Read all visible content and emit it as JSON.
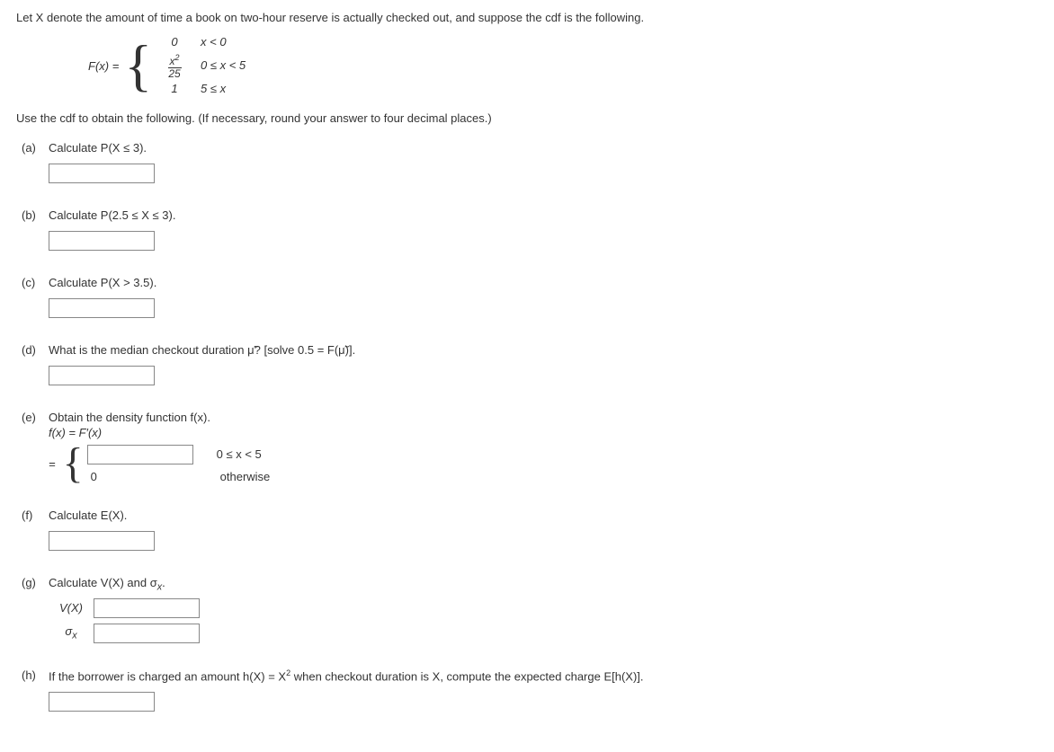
{
  "intro": "Let X denote the amount of time a book on two-hour reserve is actually checked out, and suppose the cdf is the following.",
  "cdf": {
    "func": "F(x) =",
    "cases": [
      {
        "val": "0",
        "cond": "x < 0"
      },
      {
        "val_num": "x",
        "val_sup": "2",
        "val_den": "25",
        "cond": "0 ≤ x < 5"
      },
      {
        "val": "1",
        "cond": "5 ≤ x"
      }
    ]
  },
  "instruction": "Use the cdf to obtain the following. (If necessary, round your answer to four decimal places.)",
  "parts": {
    "a": {
      "tag": "(a)",
      "text": "Calculate P(X ≤ 3)."
    },
    "b": {
      "tag": "(b)",
      "text": "Calculate P(2.5 ≤ X ≤ 3)."
    },
    "c": {
      "tag": "(c)",
      "text": "Calculate P(X > 3.5)."
    },
    "d": {
      "tag": "(d)",
      "text": "What is the median checkout duration μ̃? [solve 0.5 = F(μ̃)]."
    },
    "e": {
      "tag": "(e)",
      "text": "Obtain the density function f(x).",
      "sub": "f(x) = F′(x)",
      "eq": "=",
      "cond1": "0 ≤ x < 5",
      "val2": "0",
      "cond2": "otherwise"
    },
    "f": {
      "tag": "(f)",
      "text": "Calculate E(X)."
    },
    "g": {
      "tag": "(g)",
      "text_prefix": "Calculate V(X) and σ",
      "text_sub": "x",
      "text_suffix": ".",
      "vx": "V(X)",
      "sx_pre": "σ",
      "sx_sub": "x"
    },
    "h": {
      "tag": "(h)",
      "text_prefix": "If the borrower is charged an amount h(X) = X",
      "text_sup": "2",
      "text_suffix": " when checkout duration is X, compute the expected charge E[h(X)]."
    }
  }
}
